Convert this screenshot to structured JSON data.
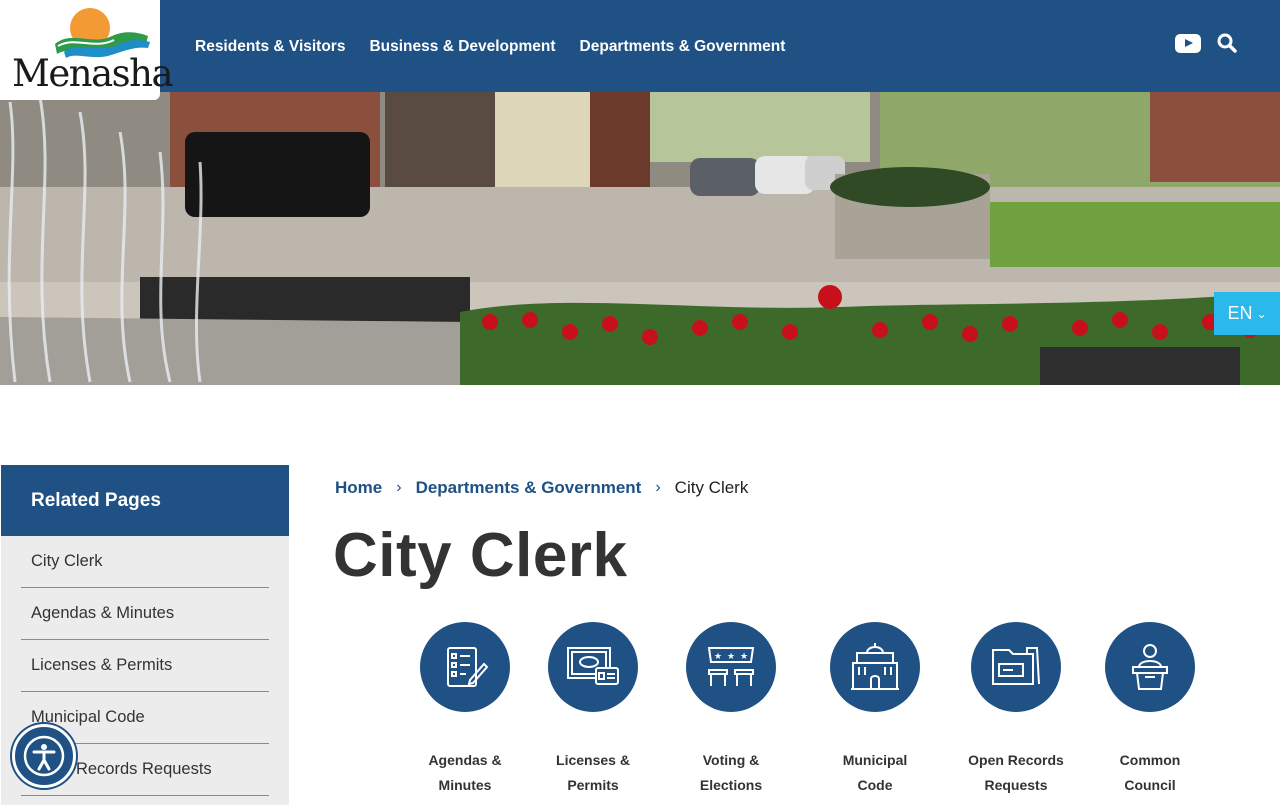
{
  "header": {
    "logo_text": "Menasha",
    "nav": [
      "Residents & Visitors",
      "Business & Development",
      "Departments & Government"
    ],
    "icons": [
      "youtube-icon",
      "search-icon"
    ]
  },
  "language": {
    "selected": "EN"
  },
  "sidebar": {
    "title": "Related Pages",
    "items": [
      "City Clerk",
      "Agendas & Minutes",
      "Licenses & Permits",
      "Municipal Code",
      "Open Records Requests"
    ]
  },
  "breadcrumb": {
    "home": "Home",
    "parent": "Departments & Government",
    "current": "City Clerk"
  },
  "page_title": "City Clerk",
  "quick_links": [
    {
      "line1": "Agendas &",
      "line2": "Minutes",
      "icon": "agenda-checklist-icon"
    },
    {
      "line1": "Licenses &",
      "line2": "Permits",
      "icon": "license-certificate-icon"
    },
    {
      "line1": "Voting &",
      "line2": "Elections",
      "icon": "voting-booth-icon"
    },
    {
      "line1": "Municipal",
      "line2": "Code",
      "icon": "city-hall-icon"
    },
    {
      "line1": "Open Records",
      "line2": "Requests",
      "icon": "folder-icon"
    },
    {
      "line1": "Common",
      "line2": "Council",
      "icon": "podium-speaker-icon"
    }
  ],
  "colors": {
    "brand": "#1f5185",
    "accent": "#2bb8eb"
  }
}
